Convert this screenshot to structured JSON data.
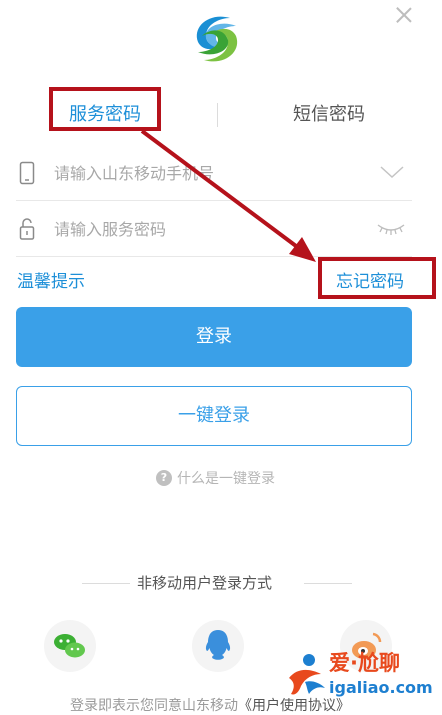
{
  "dialog": {
    "close_icon": "close-icon"
  },
  "brand": {
    "logo_icon": "china-mobile-logo"
  },
  "tabs": [
    {
      "label": "服务密码",
      "active": true
    },
    {
      "label": "短信密码",
      "active": false
    }
  ],
  "form": {
    "phone": {
      "placeholder": "请输入山东移动手机号",
      "value": "",
      "icon": "phone-icon",
      "dropdown_icon": "chevron-down-icon"
    },
    "password": {
      "placeholder": "请输入服务密码",
      "value": "",
      "icon": "lock-icon",
      "visibility_icon": "eye-closed-icon"
    }
  },
  "links": {
    "tips": "温馨提示",
    "forgot_password": "忘记密码"
  },
  "buttons": {
    "login": "登录",
    "one_key_login": "一键登录"
  },
  "help": {
    "what_is_one_key": "什么是一键登录"
  },
  "other_login": {
    "title": "非移动用户登录方式",
    "methods": [
      "wechat-icon",
      "qq-icon",
      "weibo-icon"
    ]
  },
  "footer": {
    "agreement_prefix": "登录即表示您同意山东移动",
    "agreement_link": "《用户使用协议》"
  },
  "watermark": {
    "title": "爱·尬聊",
    "url": "igaliao.com"
  },
  "annotation": {
    "color": "#b5121b"
  },
  "colors": {
    "accent": "#1d8fd8",
    "button": "#3aa0e8"
  }
}
